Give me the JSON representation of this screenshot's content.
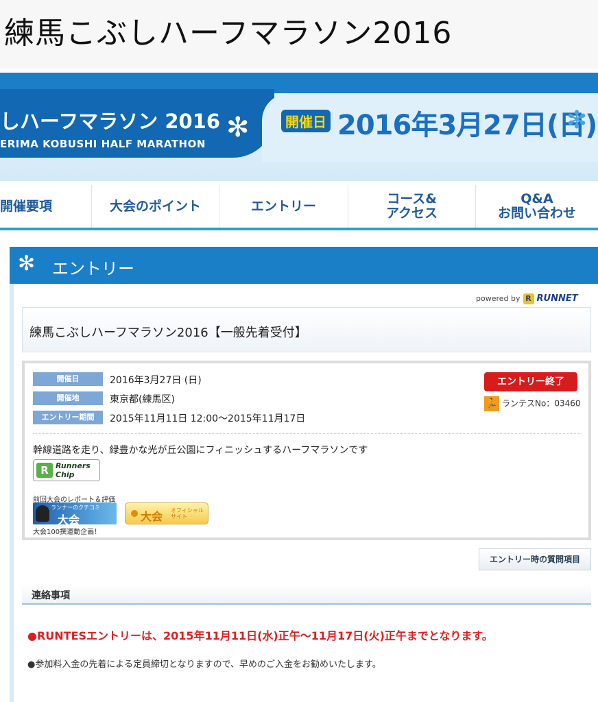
{
  "page": {
    "title": "練馬こぶしハーフマラソン2016"
  },
  "banner": {
    "title": "しハーフマラソン 2016",
    "subtitle": "ERIMA KOBUSHI HALF MARATHON",
    "kaisai_label": "開催日",
    "date": "2016年3月27日(日)",
    "accent_color": "#1b7fc8",
    "date_color": "#1a6fc0",
    "kaisai_text_color": "#ffd800"
  },
  "nav": {
    "items": [
      {
        "label": "開催要項"
      },
      {
        "label": "大会のポイント"
      },
      {
        "label": "エントリー"
      },
      {
        "label": "コース&\nアクセス"
      },
      {
        "label": "Q&A\nお問い合わせ"
      }
    ]
  },
  "section": {
    "title": "エントリー"
  },
  "powered": {
    "prefix": "powered by",
    "brand_mark": "R",
    "brand": "RUNNET"
  },
  "event": {
    "title": "練馬こぶしハーフマラソン2016【一般先着受付】",
    "rows": [
      {
        "label": "開催日",
        "value": "2016年3月27日 (日)"
      },
      {
        "label": "開催地",
        "value": "東京都(練馬区)"
      },
      {
        "label": "エントリー期間",
        "value": "2015年11月11日 12:00〜2015年11月17日"
      }
    ],
    "status_button": "エントリー終了",
    "status_color": "#d81b1b",
    "runtes_label": "ランテスNo：03460",
    "description": "幹線道路を走り、緑豊かな光が丘公園にフィニッシュするハーフマラソンです",
    "chip_logo_mark": "R",
    "chip_logo_text": "Runners\nChip",
    "prev_report_label": "前回大会のレポート＆評価",
    "taikai_banner_small": "ランナーのクチコミ",
    "taikai_banner_big": "大会",
    "official_big": "大会",
    "official_small": "オフィシャル\nサイト",
    "vote_label": "大会100撰運動企画！"
  },
  "question_button": "エントリー時の質問項目",
  "contact": {
    "header": "連絡事項",
    "notice_red": "●RUNTESエントリーは、2015年11月11日(水)正午〜11月17日(火)正午までとなります。",
    "notice_gray": "●参加料入金の先着による定員締切となりますので、早めのご入金をお勧めいたします。",
    "notice_red_color": "#e01d1d"
  }
}
